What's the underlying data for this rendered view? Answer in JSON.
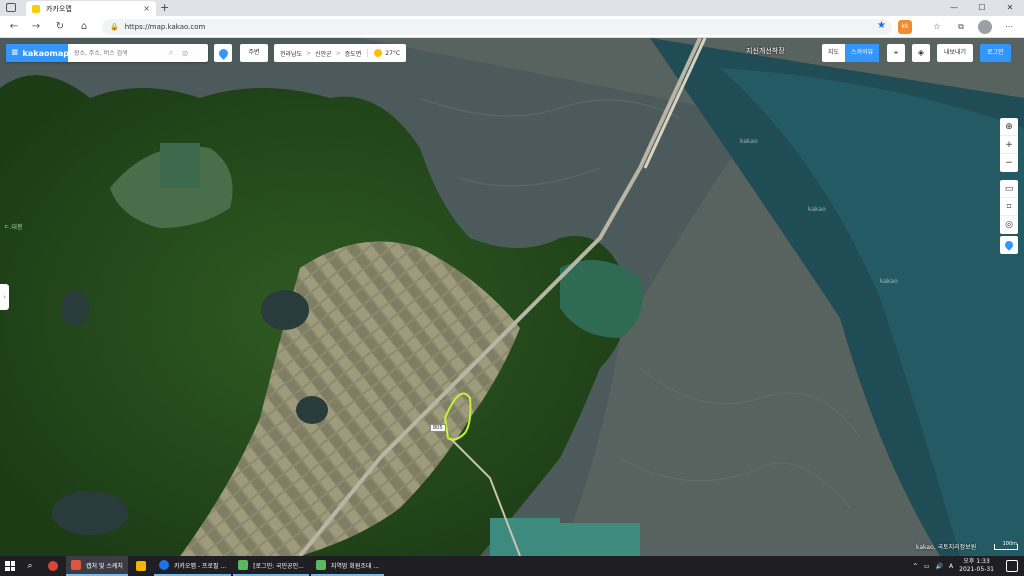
{
  "browser": {
    "tab_title": "카카오맵",
    "tab_close": "×",
    "new_tab": "+",
    "window_controls": [
      "—",
      "☐",
      "✕"
    ],
    "nav": {
      "back": "←",
      "forward": "→",
      "reload": "↻",
      "home": "⌂"
    },
    "url": "https://map.kakao.com",
    "lock": "🔒",
    "star": "★",
    "ext_badge": "kk",
    "icons": [
      "☆",
      "⧉",
      "⋯"
    ]
  },
  "map": {
    "brand": "kakaomap",
    "menu_icon": "≡",
    "search_placeholder": "장소, 주소, 버스 검색",
    "search_icon": "⌕",
    "clear_icon": "⊘",
    "nearby": "주변",
    "region": [
      "전라남도",
      "신안군",
      "증도면"
    ],
    "region_sep": ">",
    "weather": "27°C",
    "top_label": "지신개선착장",
    "map_types": [
      "지도",
      "스카이뷰"
    ],
    "map_type_selected": "스카이뷰",
    "layer_icons": {
      "pin": "⌖",
      "layers": "◈"
    },
    "export": "내보내기",
    "login": "로그인",
    "right_controls_top": [
      "⊕",
      "+",
      "−"
    ],
    "right_controls_tools": [
      "▭",
      "⌗",
      "◎"
    ],
    "side_tab": "›",
    "copyright": "kakao, 국토지리정보원",
    "scale": "100m",
    "road_number": "805",
    "sea_labels": [
      "kakao",
      "kakao",
      "kakao"
    ],
    "place_label": "ㄷ.대봉"
  },
  "taskbar": {
    "search_icon": "⌕",
    "apps": [
      {
        "label": "캡처 및 스케치",
        "color": "#e0533c",
        "active": true
      },
      {
        "label": "",
        "color": "#f4b400",
        "active": false
      },
      {
        "label": "카카오맵 - 프로필 ...",
        "color": "#1a73e8",
        "active": false
      },
      {
        "label": "[로그인: 국민공인...",
        "color": "#5cb85c",
        "active": false
      },
      {
        "label": "지역맘 회원조대 ...",
        "color": "#5cb85c",
        "active": false
      }
    ],
    "tray": [
      "^",
      "▭",
      "🔊",
      "A"
    ],
    "time": "오후 1:33",
    "date": "2021-05-31"
  }
}
